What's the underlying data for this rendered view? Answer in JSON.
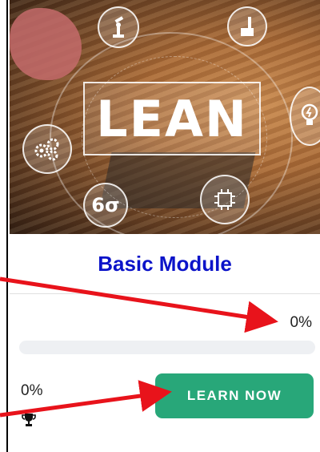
{
  "hero": {
    "banner_text": "LEAN",
    "sigma_text": "6σ"
  },
  "module": {
    "title": "Basic Module",
    "progress_top_label": "0%",
    "progress_fraction": 0,
    "progress_bottom_label": "0%",
    "button_label": "LEARN NOW"
  },
  "colors": {
    "title": "#0b13c9",
    "button": "#28a779",
    "arrow": "#e8131b"
  },
  "icons": [
    "robot-arm-icon",
    "factory-icon",
    "lightbulb-icon",
    "gears-icon",
    "circuit-chip-icon",
    "trophy-icon",
    "arrow-annotation"
  ]
}
